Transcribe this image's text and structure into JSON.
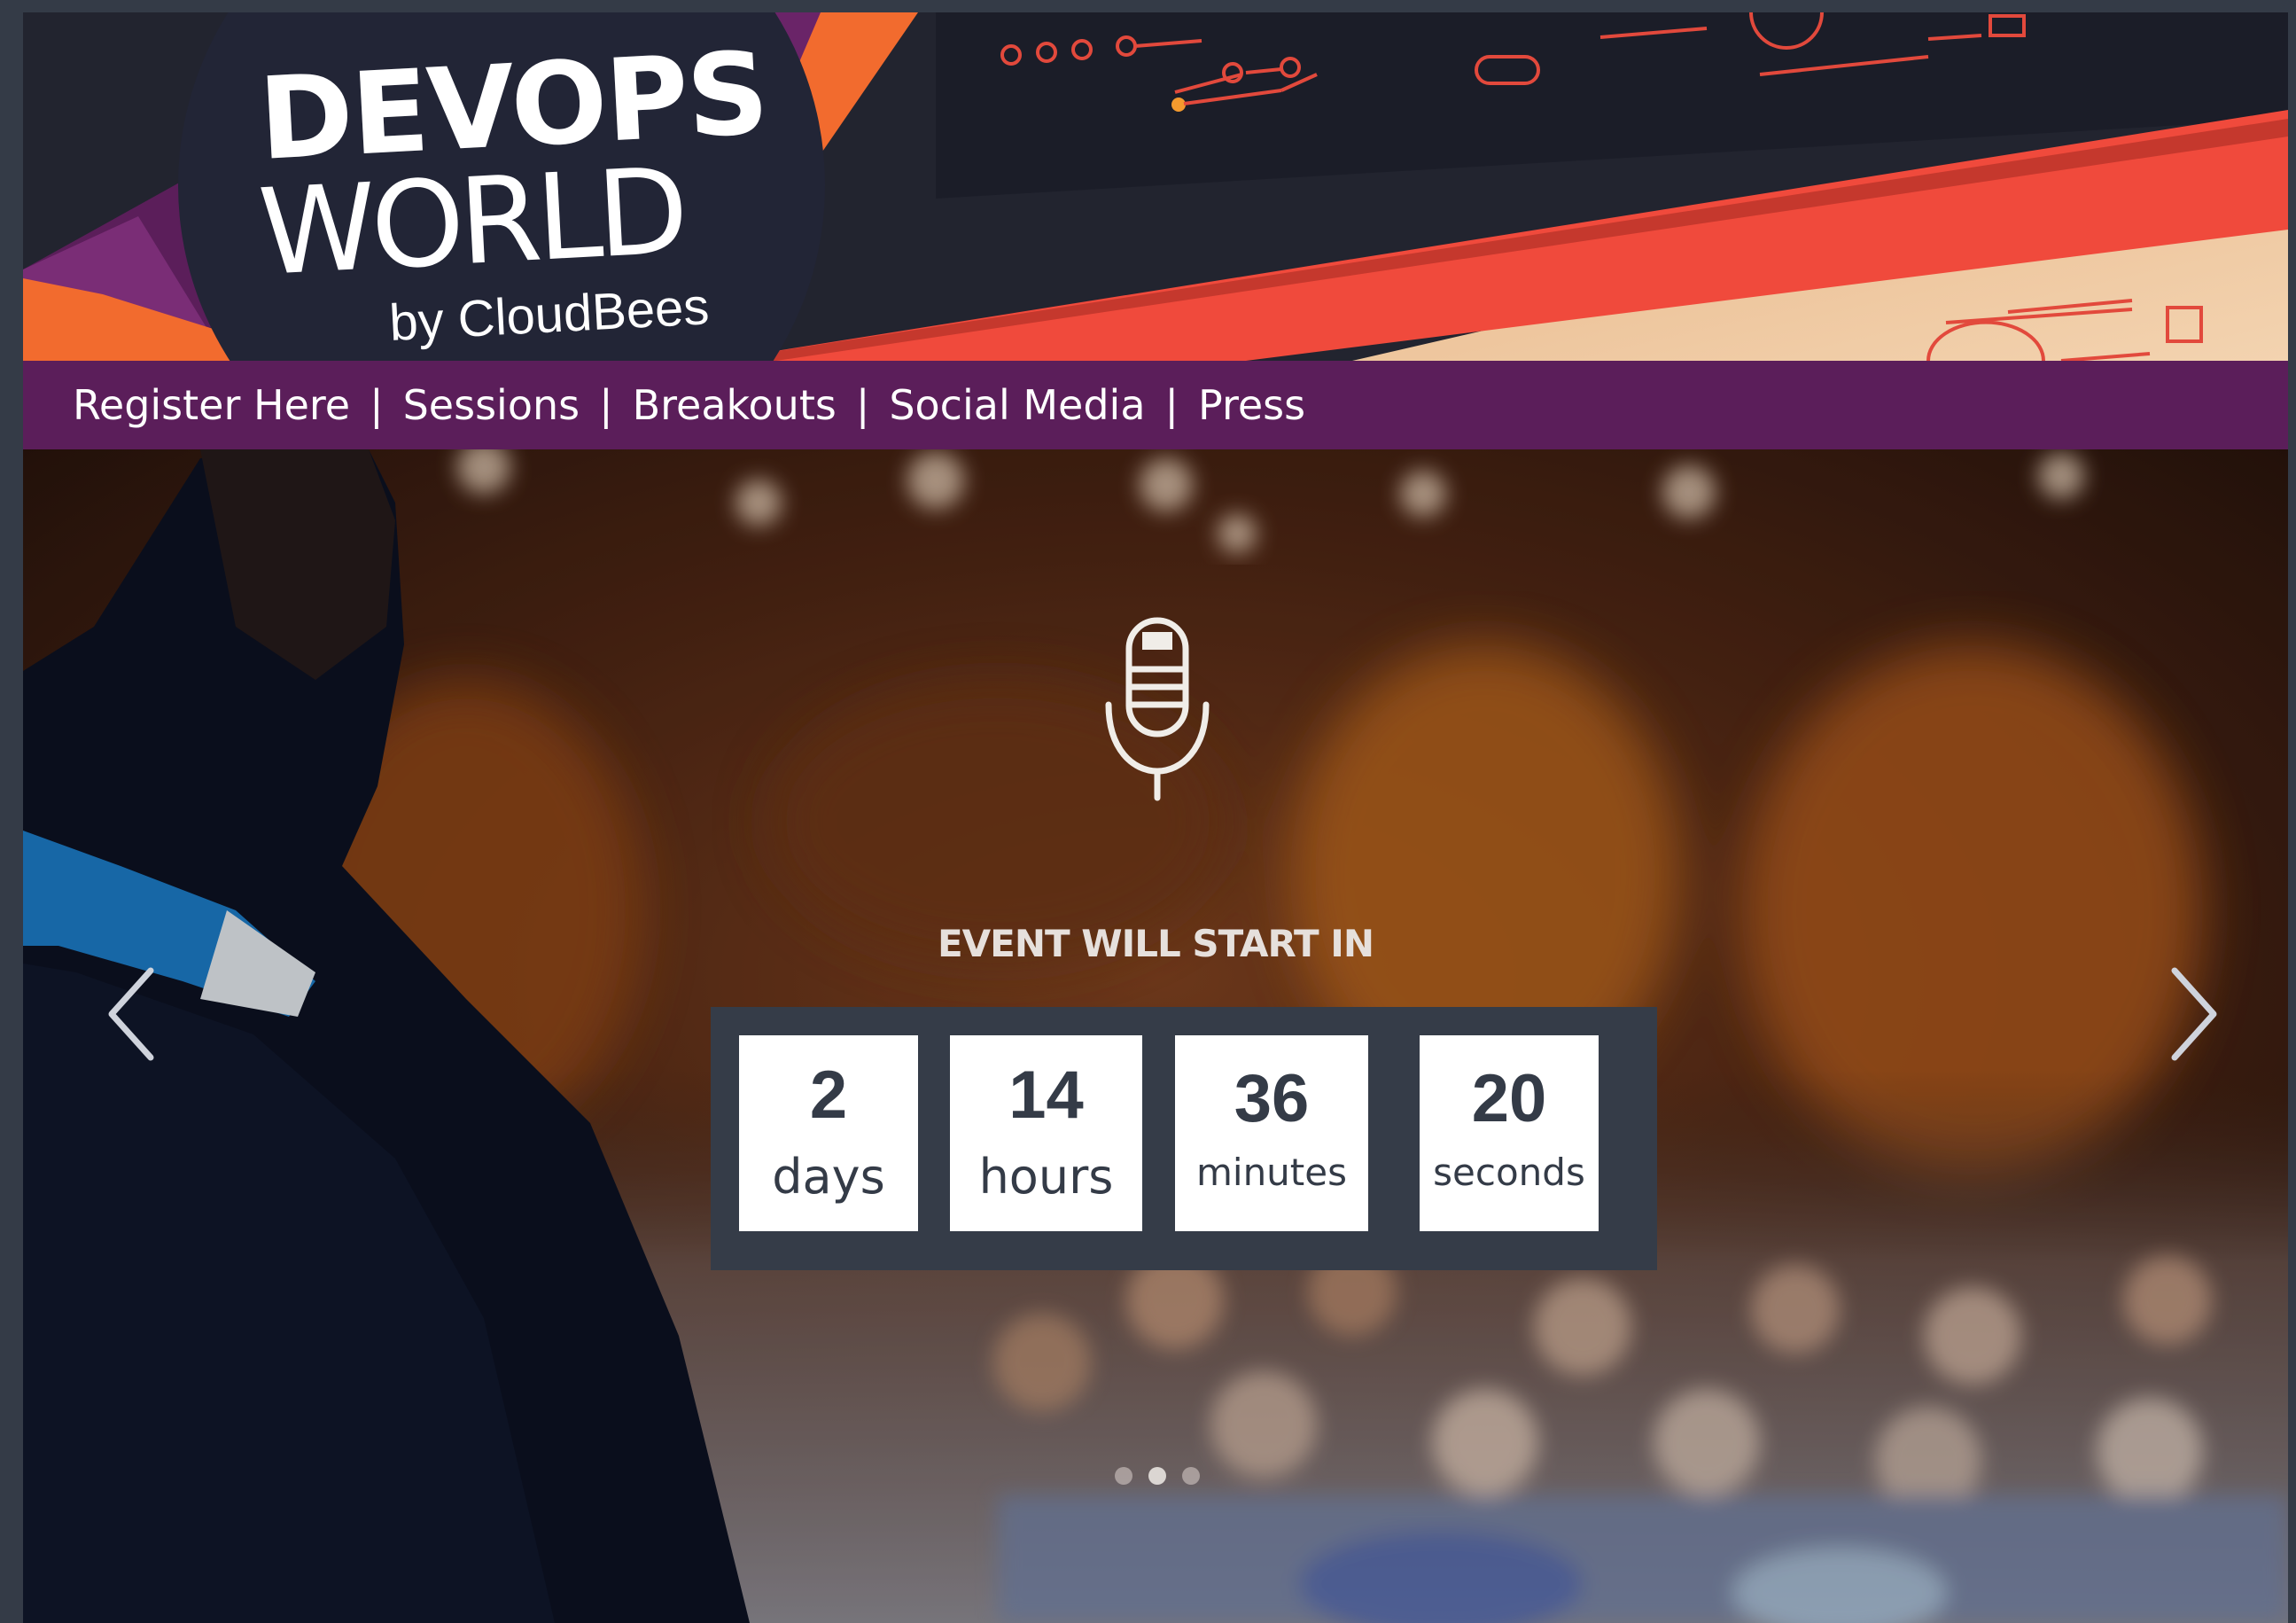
{
  "logo": {
    "line1": "DEVOPS",
    "line2": "WORLD",
    "line3": "by CloudBees"
  },
  "nav": {
    "items": [
      "Register Here",
      "Sessions",
      "Breakouts",
      "Social Media",
      "Press"
    ],
    "separator": "|"
  },
  "hero": {
    "event_title": "EVENT WILL START IN",
    "slides": {
      "count": 3,
      "active_index": 1
    }
  },
  "countdown": {
    "days": {
      "value": "2",
      "label": "days"
    },
    "hours": {
      "value": "14",
      "label": "hours"
    },
    "minutes": {
      "value": "36",
      "label": "minutes"
    },
    "seconds": {
      "value": "20",
      "label": "seconds"
    }
  },
  "colors": {
    "nav_bg": "#5b1e5a",
    "banner_dark": "#1f2230",
    "accent_red": "#f04a3c",
    "accent_orange": "#f26b2e",
    "countdown_bg": "#353c48"
  },
  "icons": [
    "microphone-icon",
    "chevron-left-icon",
    "chevron-right-icon"
  ]
}
